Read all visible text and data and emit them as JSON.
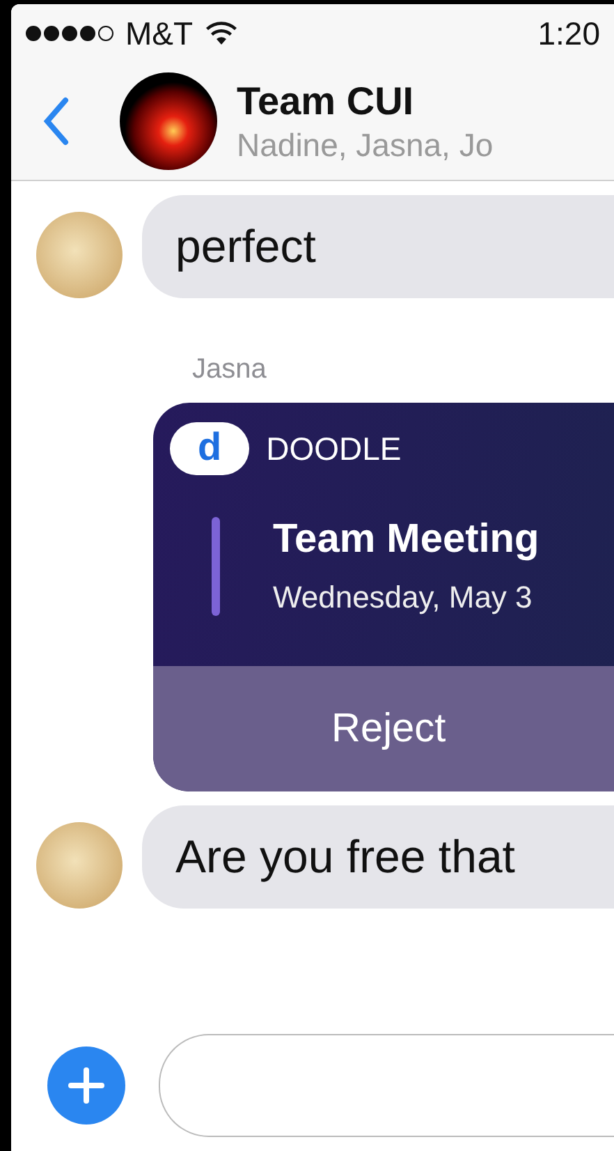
{
  "status_bar": {
    "carrier": "M&T",
    "time": "1:20"
  },
  "header": {
    "title": "Team CUI",
    "subtitle": "Nadine, Jasna, Jo"
  },
  "messages": [
    {
      "kind": "bubble",
      "text": "perfect"
    },
    {
      "kind": "sender",
      "text": "Jasna"
    },
    {
      "kind": "card",
      "app_logo": "d",
      "app_name": "DOODLE",
      "title": "Team Meeting",
      "subtitle": "Wednesday, May 3",
      "action": "Reject"
    },
    {
      "kind": "bubble",
      "text": "Are you free that"
    }
  ]
}
